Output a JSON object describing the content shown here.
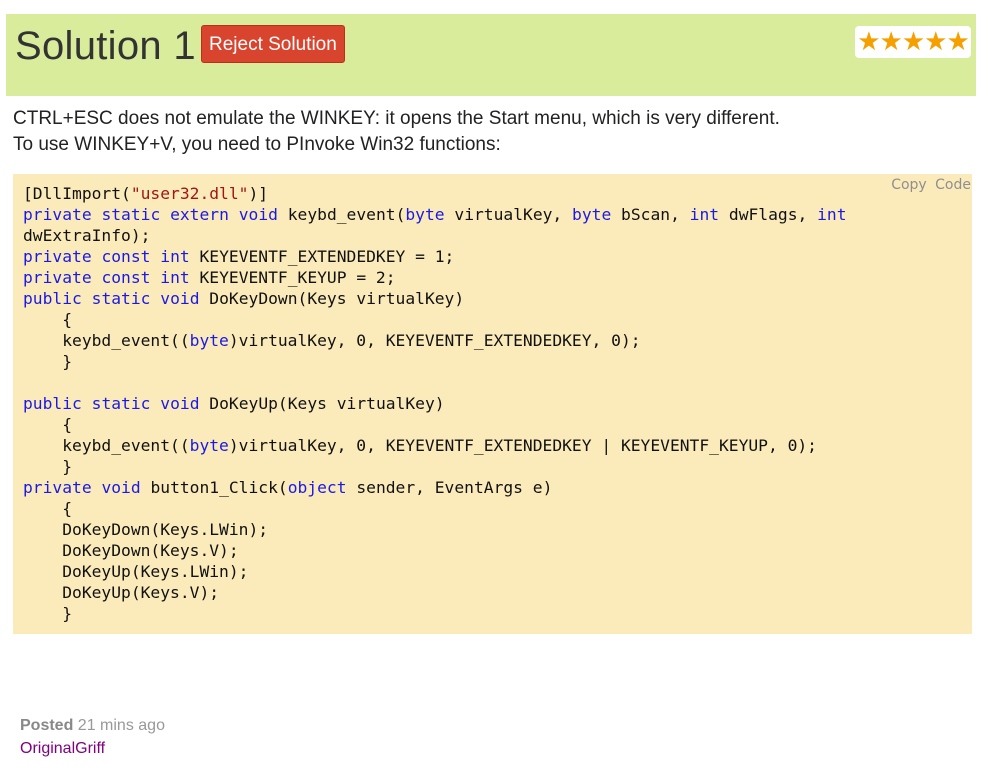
{
  "header": {
    "title": "Solution 1",
    "reject_label": "Reject Solution",
    "rating_stars": "★★★★★",
    "rating_value": 5,
    "rating_max": 5,
    "bg_color": "#d8ec9b",
    "reject_color": "#d9442f"
  },
  "answer": {
    "line1": "CTRL+ESC does not emulate the WINKEY: it opens the Start menu, which is very different.",
    "line2": "To use WINKEY+V, you need to PInvoke Win32 functions:"
  },
  "code": {
    "copy_label": "Copy Code",
    "language": "C#",
    "lines": [
      "[DllImport(\"user32.dll\")]",
      "private static extern void keybd_event(byte virtualKey, byte bScan, int dwFlags, int",
      "dwExtraInfo);",
      "private const int KEYEVENTF_EXTENDEDKEY = 1;",
      "private const int KEYEVENTF_KEYUP = 2;",
      "public static void DoKeyDown(Keys virtualKey)",
      "    {",
      "    keybd_event((byte)virtualKey, 0, KEYEVENTF_EXTENDEDKEY, 0);",
      "    }",
      "",
      "public static void DoKeyUp(Keys virtualKey)",
      "    {",
      "    keybd_event((byte)virtualKey, 0, KEYEVENTF_EXTENDEDKEY | KEYEVENTF_KEYUP, 0);",
      "    }",
      "private void button1_Click(object sender, EventArgs e)",
      "    {",
      "    DoKeyDown(Keys.LWin);",
      "    DoKeyDown(Keys.V);",
      "    DoKeyUp(Keys.LWin);",
      "    DoKeyUp(Keys.V);",
      "    }"
    ],
    "bg_color": "#fbebbb",
    "keyword_color": "#1a1ae6",
    "string_color": "#a31515"
  },
  "meta": {
    "posted_label": "Posted",
    "posted_time": "21 mins ago",
    "author": "OriginalGriff"
  }
}
